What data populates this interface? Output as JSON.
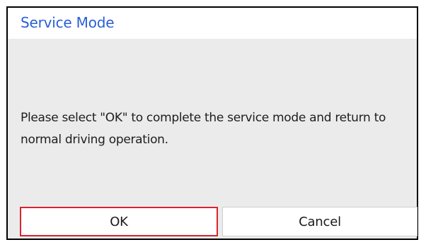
{
  "dialog": {
    "title": "Service Mode",
    "message": "Please select \"OK\" to complete the service mode and return to normal driving operation.",
    "ok_label": "OK",
    "cancel_label": "Cancel"
  },
  "colors": {
    "title_text": "#2a5fd8",
    "dialog_background": "#ebebeb",
    "focus_border": "#d9232f"
  }
}
